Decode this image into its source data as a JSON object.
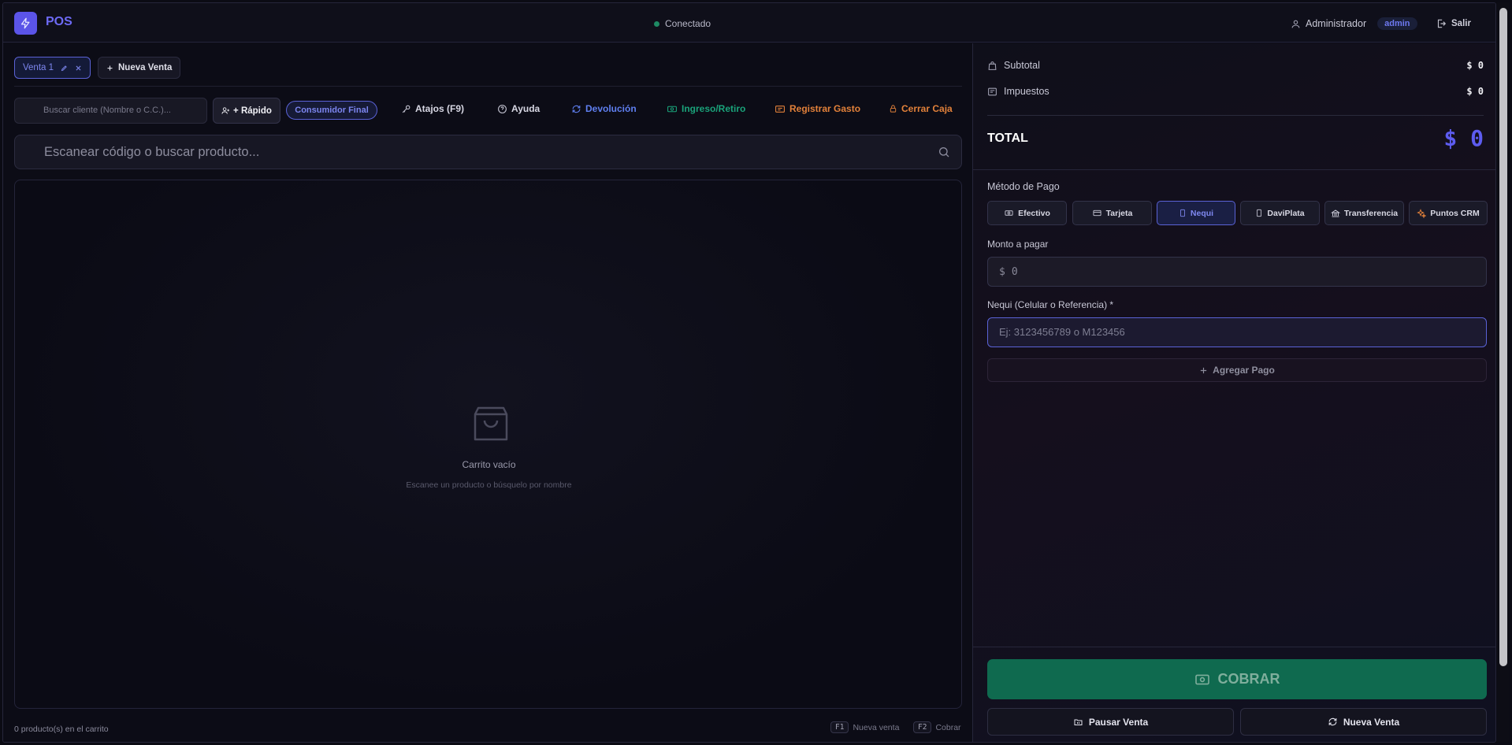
{
  "header": {
    "app_title": "POS",
    "status": "Conectado",
    "user_name": "Administrador",
    "role_badge": "admin",
    "logout_label": "Salir"
  },
  "tabs": {
    "active_tab": "Venta 1",
    "new_sale_label": "Nueva Venta"
  },
  "toolbar": {
    "customer_placeholder": "Buscar cliente (Nombre o C.C.)...",
    "quick_label": "+ Rápido",
    "default_customer": "Consumidor Final",
    "shortcuts": "Atajos (F9)",
    "help": "Ayuda",
    "refund": "Devolución",
    "cash_in_out": "Ingreso/Retiro",
    "expense": "Registrar Gasto",
    "close_register": "Cerrar Caja"
  },
  "search": {
    "placeholder": "Escanear código o buscar producto..."
  },
  "cart": {
    "empty_title": "Carrito vacío",
    "empty_subtitle": "Escanee un producto o búsquelo por nombre",
    "count_text": "0 producto(s) en el carrito"
  },
  "footer_shortcuts": [
    {
      "key": "F1",
      "label": "Nueva venta"
    },
    {
      "key": "F2",
      "label": "Cobrar"
    }
  ],
  "summary": {
    "subtotal_label": "Subtotal",
    "subtotal_value": "$ 0",
    "tax_label": "Impuestos",
    "tax_value": "$ 0",
    "total_label": "TOTAL",
    "total_value": "$ 0"
  },
  "payment": {
    "method_label": "Método de Pago",
    "methods": [
      "Efectivo",
      "Tarjeta",
      "Nequi",
      "DaviPlata",
      "Transferencia",
      "Puntos CRM"
    ],
    "selected_method": "Nequi",
    "amount_label": "Monto a pagar",
    "amount_currency": "$",
    "amount_value": "0",
    "reference_label": "Nequi (Celular o Referencia) *",
    "reference_placeholder": "Ej: 3123456789 o M123456",
    "add_payment": "Agregar Pago"
  },
  "actions": {
    "charge": "COBRAR",
    "pause": "Pausar Venta",
    "new_sale": "Nueva Venta"
  },
  "colors": {
    "accent": "#5b54e8",
    "success": "#0f6a4f",
    "refund": "#5a7cf0",
    "cash": "#1aa37a",
    "expense": "#e2813a",
    "close": "#e2813a"
  }
}
